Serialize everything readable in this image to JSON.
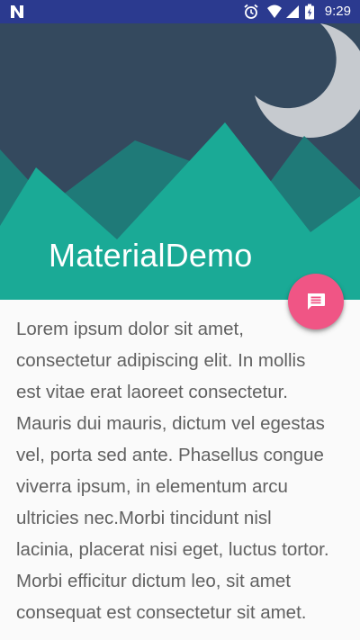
{
  "status_bar": {
    "time": "9:29",
    "icons": [
      "n-logo-icon",
      "alarm-icon",
      "wifi-icon",
      "signal-icon",
      "battery-icon"
    ]
  },
  "header": {
    "title": "MaterialDemo",
    "colors": {
      "sky": "#34495e",
      "mountain_back": "#1f7a78",
      "mountain_front": "#1aaa96",
      "moon": "#c6cacf"
    }
  },
  "fab": {
    "icon": "message-icon",
    "color": "#f05585"
  },
  "content": {
    "text": "Lorem ipsum dolor sit amet, consectetur adipiscing elit. In mollis est vitae erat laoreet consectetur. Mauris dui mauris, dictum vel egestas vel, porta sed ante. Phasellus congue viverra ipsum, in elementum arcu ultricies nec.Morbi tincidunt nisl lacinia, placerat nisi eget, luctus tortor. Morbi efficitur dictum leo, sit amet consequat est consectetur sit amet."
  }
}
